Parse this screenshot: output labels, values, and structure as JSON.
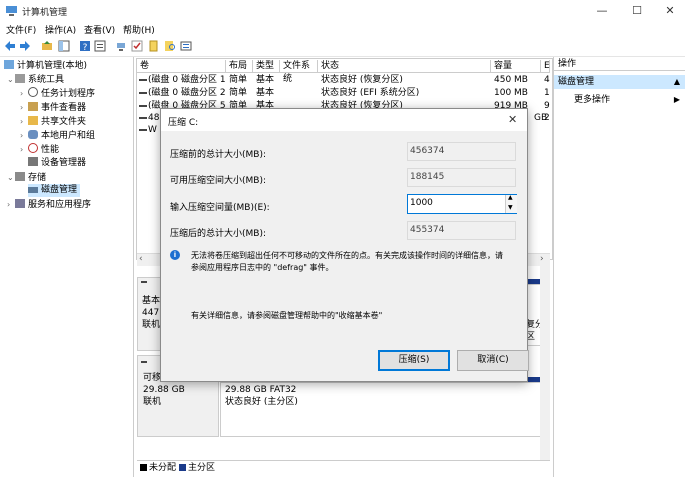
{
  "window": {
    "title": "计算机管理",
    "minimize": "—",
    "maximize": "☐",
    "close": "✕"
  },
  "menu": [
    "文件(F)",
    "操作(A)",
    "查看(V)",
    "帮助(H)"
  ],
  "tree": {
    "root": "计算机管理(本地)",
    "system_tools": "系统工具",
    "task_scheduler": "任务计划程序",
    "event_viewer": "事件查看器",
    "shared_folders": "共享文件夹",
    "local_users": "本地用户和组",
    "performance": "性能",
    "device_manager": "设备管理器",
    "storage": "存储",
    "disk_management": "磁盘管理",
    "services_apps": "服务和应用程序"
  },
  "table": {
    "headers": [
      "卷",
      "布局",
      "类型",
      "文件系统",
      "状态",
      "容量",
      "E"
    ],
    "rows": [
      {
        "vol": "(磁盘 0 磁盘分区 1)",
        "layout": "简单",
        "type": "基本",
        "fs": "",
        "status": "状态良好 (恢复分区)",
        "cap": "450 MB",
        "e": "4"
      },
      {
        "vol": "(磁盘 0 磁盘分区 2)",
        "layout": "简单",
        "type": "基本",
        "fs": "",
        "status": "状态良好 (EFI 系统分区)",
        "cap": "100 MB",
        "e": "1"
      },
      {
        "vol": "(磁盘 0 磁盘分区 5)",
        "layout": "简单",
        "type": "基本",
        "fs": "",
        "status": "状态良好 (恢复分区)",
        "cap": "919 MB",
        "e": "9"
      },
      {
        "vol": "48",
        "layout": "",
        "type": "",
        "fs": "",
        "status": "",
        "cap": "GB",
        "e": "2"
      },
      {
        "vol": "W",
        "layout": "",
        "type": "",
        "fs": "",
        "status": "",
        "cap": "",
        "e": ""
      }
    ]
  },
  "actions": {
    "header": "操作",
    "section": "磁盘管理",
    "more": "更多操作"
  },
  "dialog": {
    "title": "压缩 C:",
    "total_before_label": "压缩前的总计大小(MB):",
    "total_before_value": "456374",
    "available_label": "可用压缩空间大小(MB):",
    "available_value": "188145",
    "input_label": "输入压缩空间量(MB)(E):",
    "input_value": "1000",
    "total_after_label": "压缩后的总计大小(MB):",
    "total_after_value": "455374",
    "info_line1": "无法将卷压缩到超出任何不可移动的文件所在的点。有关完成该操作时间的详细信息，请",
    "info_line2": "参阅应用程序日志中的 \"defrag\" 事件。",
    "more_info": "有关详细信息，请参阅磁盘管理帮助中的\"收缩基本卷\"",
    "ok": "压缩(S)",
    "cancel": "取消(C)"
  },
  "lower": {
    "disk0_type": "基本",
    "disk0_size": "447.",
    "disk0_status": "联机",
    "removable": "可移",
    "removable_size": "29.88 GB",
    "removable_status": "联机",
    "part_size": "29.88 GB FAT32",
    "part_status": "状态良好 (主分区)",
    "right_frag": "复分区"
  },
  "legend": {
    "unallocated": "未分配",
    "primary": "主分区"
  },
  "colors": {
    "accent": "#0078d7",
    "selected_bg": "#cce8ff",
    "disk_bar": "#1a3a8a"
  }
}
